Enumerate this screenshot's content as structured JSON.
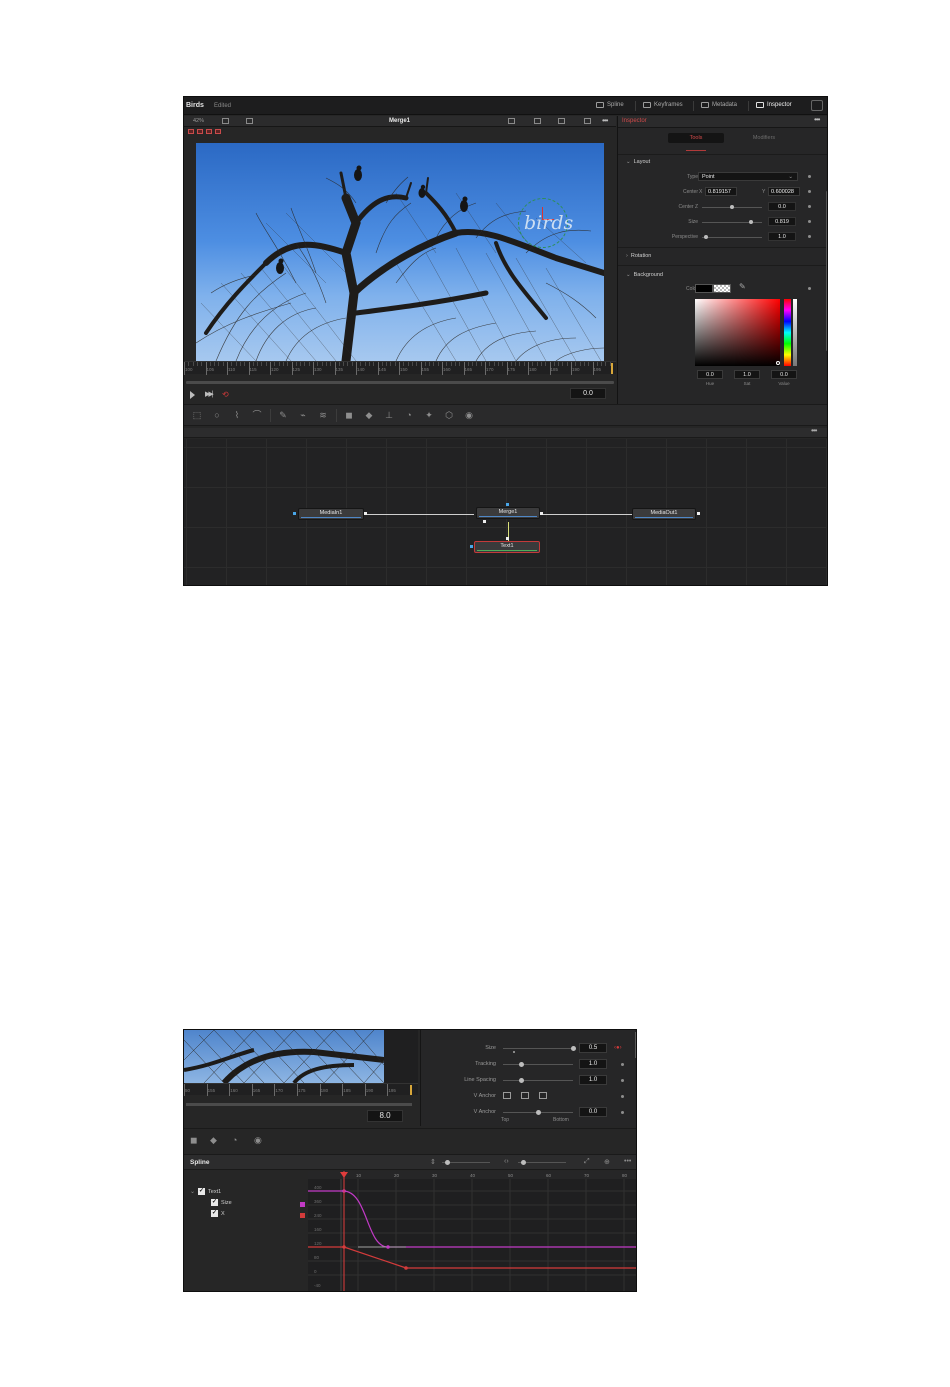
{
  "app1": {
    "project": "Birds",
    "status": "Edited",
    "top_tabs": [
      {
        "label": "Spline",
        "icon": "spline-icon"
      },
      {
        "label": "Keyframes",
        "icon": "keyframes-icon"
      },
      {
        "label": "Metadata",
        "icon": "metadata-icon"
      },
      {
        "label": "Inspector",
        "icon": "inspector-icon",
        "active": true
      }
    ],
    "viewer": {
      "zoom": "42%",
      "title": "Merge1",
      "overlay_text": "birds",
      "ruler_labels": [
        "100",
        "105",
        "110",
        "115",
        "120",
        "125",
        "130",
        "135",
        "140",
        "145",
        "150",
        "155",
        "160",
        "165",
        "170",
        "175",
        "180",
        "185",
        "190",
        "195"
      ],
      "current_time": "0.0"
    },
    "inspector": {
      "title": "Inspector",
      "tabs": {
        "tools": "Tools",
        "modifiers": "Modifiers"
      },
      "sections": {
        "layout": "Layout",
        "rotation": "Rotation",
        "background": "Background"
      },
      "type_label": "Type",
      "type_value": "Point",
      "center_label": "Center",
      "center_x_label": "X",
      "center_x": "0.819157",
      "center_y_label": "Y",
      "center_y": "0.600028",
      "params": [
        {
          "label": "Center Z",
          "value": "0.0",
          "level": 0.5
        },
        {
          "label": "Size",
          "value": "0.819",
          "level": 0.82
        },
        {
          "label": "Perspective",
          "value": "1.0",
          "level": 0.0
        }
      ],
      "color_label": "Color",
      "hsv": [
        {
          "label": "Hue",
          "value": "0.0"
        },
        {
          "label": "Sat",
          "value": "1.0"
        },
        {
          "label": "Value",
          "value": "0.0"
        }
      ]
    },
    "nodes": {
      "media_in": "MediaIn1",
      "merge": "Merge1",
      "media_out": "MediaOut1",
      "text": "Text1"
    }
  },
  "app2": {
    "ruler_labels": [
      "50",
      "155",
      "160",
      "165",
      "170",
      "175",
      "180",
      "185",
      "190",
      "195"
    ],
    "current_time": "8.0",
    "params": [
      {
        "label": "Size",
        "value": "0.5",
        "level": 1.0
      },
      {
        "label": "Tracking",
        "value": "1.0",
        "level": 0.25
      },
      {
        "label": "Line Spacing",
        "value": "1.0",
        "level": 0.25
      }
    ],
    "v_anchor_label": "V Anchor",
    "v_anchor2_label": "V Anchor",
    "v_anchor2_value": "0.0",
    "v_anchor2_level": 0.5,
    "top_label": "Top",
    "bottom_label": "Bottom",
    "spline_title": "Spline",
    "tree": {
      "root": "Text1",
      "children": [
        "Size",
        "X"
      ]
    },
    "graph_x_labels": [
      "10",
      "20",
      "30",
      "40",
      "50",
      "60",
      "70",
      "80"
    ],
    "graph_y_labels": [
      "400",
      "360",
      "240",
      "160",
      "120",
      "80",
      "0",
      "-40"
    ],
    "colors": {
      "size_curve": "#c23ac6",
      "x_curve": "#d33b3b",
      "playhead": "#e03c3c"
    }
  }
}
